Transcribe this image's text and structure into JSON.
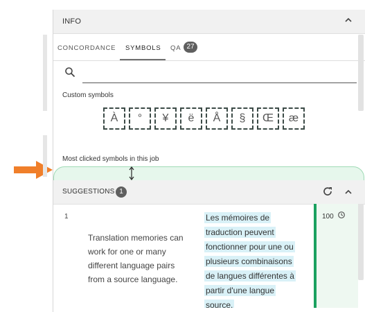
{
  "info": {
    "title": "INFO",
    "tabs": [
      {
        "label": "CONCORDANCE"
      },
      {
        "label": "SYMBOLS"
      },
      {
        "label": "QA"
      }
    ],
    "qa_count": "27",
    "search_placeholder": "",
    "custom_symbols_label": "Custom symbols",
    "symbols": [
      "À",
      "°",
      "¥",
      "ë",
      "Å",
      "§",
      "Œ",
      "æ"
    ],
    "most_clicked_label": "Most clicked symbols in this job"
  },
  "suggestions": {
    "title": "SUGGESTIONS",
    "count": "1",
    "items": [
      {
        "number": "1",
        "source": "Translation memories can work for one or many different language pairs from a source language.",
        "target": "Les mémoires de traduction peuvent fonctionner pour une ou plusieurs combinaisons de langues différentes à partir d'une langue source.",
        "score": "100"
      }
    ]
  },
  "colors": {
    "accent_green": "#1aa15f",
    "arrow_orange": "#f07f2a",
    "highlight_blue": "#d9f1f7"
  }
}
